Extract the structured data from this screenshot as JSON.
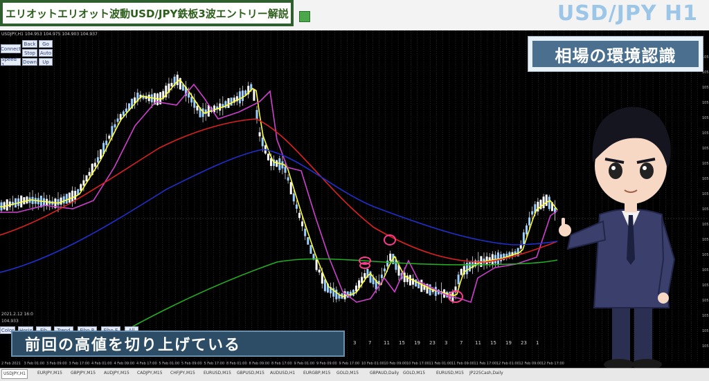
{
  "header": {
    "banner_title": "エリオットエリオット波動USD/JPY鉄板3波エントリー解説",
    "pair_title": "USD/JPY H1"
  },
  "chart": {
    "ohlc_text": "USDJPY,H1  104.953 104.975 104.903 104.937",
    "date_label": "2021.2.12 16:0",
    "price_label": "104.933",
    "x_numbers": [
      "3",
      "7",
      "11",
      "15",
      "19",
      "23",
      "3",
      "7",
      "11",
      "15",
      "19",
      "23",
      "1"
    ]
  },
  "controls": {
    "row1": [
      "Back",
      "Go"
    ],
    "row2": [
      "Connect",
      "Stop",
      "Auto"
    ],
    "row3": [
      "Speed 1",
      "Down",
      "Up"
    ],
    "bottom": [
      "Horiz",
      "Fib",
      "Trend",
      "Fibo R",
      "Fibo E",
      "All"
    ],
    "color_label": "Color"
  },
  "overlay": {
    "box_caption": "相場の環境認識",
    "subtitle": "前回の高値を切り上げている"
  },
  "x_axis_dates": [
    "2 Feb 2021",
    "3 Feb 01:00",
    "3 Feb 09:00",
    "3 Feb 17:00",
    "4 Feb 01:00",
    "4 Feb 09:00",
    "4 Feb 17:00",
    "5 Feb 01:00",
    "5 Feb 09:00",
    "5 Feb 17:00",
    "8 Feb 01:00",
    "8 Feb 09:00",
    "8 Feb 17:00",
    "9 Feb 01:00",
    "9 Feb 09:00",
    "9 Feb 17:00",
    "10 Feb 01:00",
    "10 Feb 09:00",
    "10 Feb 17:00",
    "11 Feb 01:00",
    "11 Feb 09:00",
    "11 Feb 17:00",
    "12 Feb 01:00",
    "12 Feb 09:00",
    "12 Feb 17:00"
  ],
  "tabs": [
    "USDJPY,H1",
    "EURJPY,M15",
    "GBPJPY,M15",
    "AUDJPY,M15",
    "CADJPY,M15",
    "CHFJPY,M15",
    "EURUSD,M15",
    "GBPUSD,M15",
    "AUDUSD,H1",
    "EURGBP,M15",
    "GOLD,M15",
    "GBPAUD,Daily",
    "GOLD,M15",
    "EURUSD,M15",
    "JP225Cash,Daily"
  ],
  "colors": {
    "ema_fast": "#ffff33",
    "ema_mid": "#d040d0",
    "ema_slow": "#e02020",
    "ema_blue": "#2030d0",
    "ema_green": "#22b022",
    "candle": "#ffffff",
    "marker": "#ff3c8e"
  },
  "markers": [
    "pink-circle-1",
    "pink-circle-2",
    "pink-circle-3",
    "pink-circle-4"
  ]
}
